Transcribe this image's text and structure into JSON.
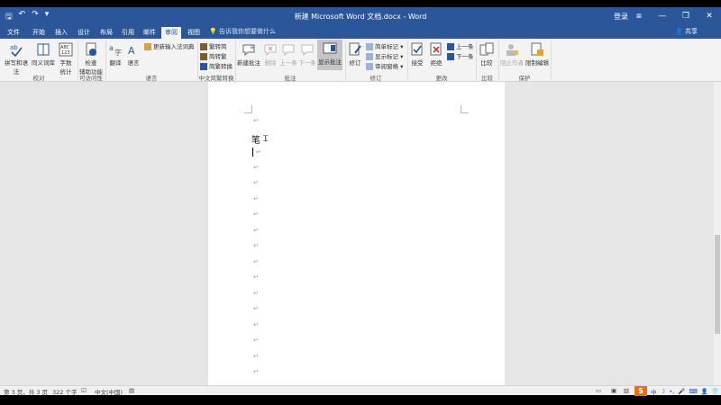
{
  "titlebar": {
    "title": "新建 Microsoft Word 文档.docx  -  Word",
    "login": "登录",
    "qa_save": "🖫",
    "qa_undo": "↶",
    "qa_redo": "↷",
    "qa_more": "▾",
    "ribbon_opt": "⧈",
    "min": "—",
    "restore": "❐",
    "close": "✕"
  },
  "tabs": [
    "文件",
    "开始",
    "插入",
    "设计",
    "布局",
    "引用",
    "邮件",
    "审阅",
    "视图"
  ],
  "tell_me": "告诉我你想要做什么",
  "share": "共享",
  "ribbon": {
    "spell": "拼写和语法",
    "thesaurus": "同义词库",
    "wordcount_1": "字数",
    "wordcount_2": "统计",
    "check_1": "检查",
    "check_2": "辅助功能",
    "translate": "翻译",
    "language": "语言",
    "update_ime": "更新输入法词典",
    "to_trad": "繁转简",
    "to_simp": "简转繁",
    "convert": "简繁转换",
    "new_comment": "新建批注",
    "delete": "删除",
    "prev": "上一条",
    "next": "下一条",
    "show_comments": "显示批注",
    "track": "修订",
    "simple_markup": "简单标记",
    "show_markup": "显示标记",
    "review_pane": "审阅窗格",
    "accept": "接受",
    "reject": "拒绝",
    "prev2": "上一条",
    "next2": "下一条",
    "compare": "比较",
    "block_authors": "阻止作者",
    "restrict_edit": "限制编辑",
    "groups": {
      "proofing": "校对",
      "accessibility": "可访问性",
      "language": "语言",
      "chinese_conv": "中文简繁转换",
      "comments": "批注",
      "tracking": "修订",
      "changes": "更改",
      "compare": "比较",
      "protect": "保护"
    }
  },
  "document": {
    "para_mark": "↵",
    "char": "笔",
    "ibeam": "Ꮖ"
  },
  "statusbar": {
    "page": "第 3 页，共 3 页",
    "words": "322 个字",
    "lang": "中文(中国)",
    "ime_s": "S",
    "ime_zh": "中",
    "ime_moon": "☽",
    "ime_dot": "•,",
    "ime_mic": "🎤",
    "ime_kb": "⌨",
    "ime_user": "👤",
    "ime_shirt": "👕",
    "ime_grid": "▦"
  }
}
